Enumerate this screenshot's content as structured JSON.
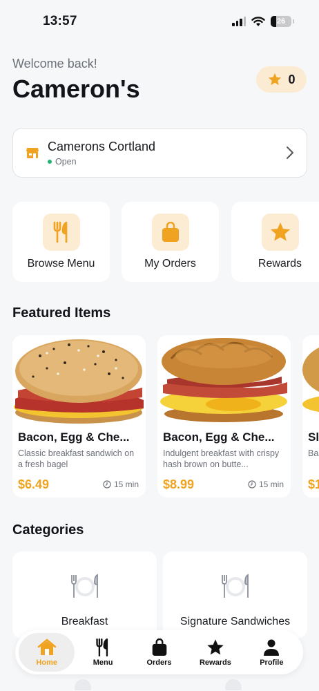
{
  "status_bar": {
    "time": "13:57",
    "battery": "26"
  },
  "header": {
    "welcome": "Welcome back!",
    "brand": "Cameron's",
    "points": "0"
  },
  "location": {
    "name": "Camerons Cortland",
    "status": "Open"
  },
  "quick_actions": [
    {
      "label": "Browse Menu",
      "icon": "fork-knife-icon"
    },
    {
      "label": "My Orders",
      "icon": "bag-icon"
    },
    {
      "label": "Rewards",
      "icon": "star-icon"
    }
  ],
  "featured": {
    "title": "Featured Items",
    "items": [
      {
        "name": "Bacon, Egg & Che...",
        "desc": "Classic breakfast sandwich on a fresh bagel",
        "price": "$6.49",
        "time": "15 min"
      },
      {
        "name": "Bacon, Egg & Che...",
        "desc": "Indulgent breakfast with crispy hash brown on butte...",
        "price": "$8.99",
        "time": "15 min"
      },
      {
        "name": "Sl",
        "desc": "Ba To",
        "price": "$1",
        "time": ""
      }
    ]
  },
  "categories": {
    "title": "Categories",
    "items": [
      {
        "label": "Breakfast",
        "icon": "plate-icon"
      },
      {
        "label": "Signature Sandwiches",
        "icon": "plate-icon"
      }
    ]
  },
  "tabs": [
    {
      "label": "Home",
      "icon": "home-icon",
      "active": true
    },
    {
      "label": "Menu",
      "icon": "fork-knife-icon",
      "active": false
    },
    {
      "label": "Orders",
      "icon": "bag-icon",
      "active": false
    },
    {
      "label": "Rewards",
      "icon": "star-icon",
      "active": false
    },
    {
      "label": "Profile",
      "icon": "person-icon",
      "active": false
    }
  ],
  "colors": {
    "accent": "#f0a321",
    "accent_soft": "#fdecd4",
    "background": "#f6f7f9",
    "open_green": "#22b573"
  }
}
